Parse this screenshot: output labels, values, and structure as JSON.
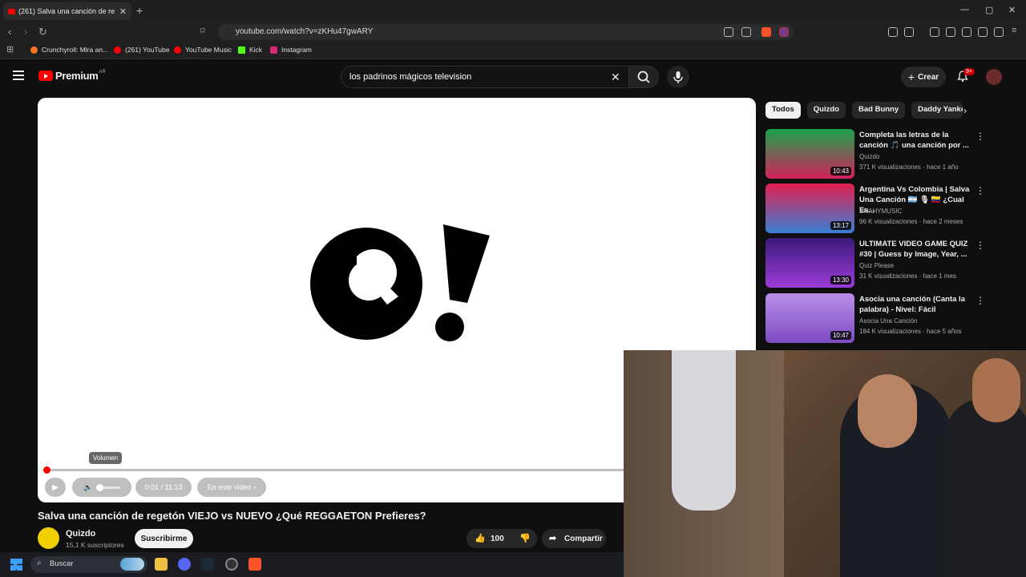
{
  "browser": {
    "tab_title": "(261) Salva una canción de re",
    "url": "youtube.com/watch?v=zKHu47gwARY",
    "bookmarks": [
      {
        "label": "Crunchyroll: Mira an...",
        "color": "#f47521"
      },
      {
        "label": "(261) YouTube",
        "color": "#ff0000"
      },
      {
        "label": "YouTube Music",
        "color": "#ff0000"
      },
      {
        "label": "Kick",
        "color": "#53fc18"
      },
      {
        "label": "Instagram",
        "color": "#d62976"
      }
    ]
  },
  "youtube": {
    "logo_text": "Premium",
    "country": "AR",
    "search_value": "los padrinos mágicos television",
    "create_label": "Crear",
    "notif_count": "9+"
  },
  "player": {
    "tooltip": "Volumen",
    "time": "0:01 / 11:13",
    "chapters": "En este video",
    "progress_fraction": 0.0015
  },
  "video": {
    "title": "Salva una canción de regetón VIEJO vs NUEVO ¿Qué REGGAETON Prefieres?",
    "channel": "Quizdo",
    "subscribers": "15,1 K suscriptores",
    "subscribe_label": "Suscribirme",
    "likes": "100",
    "share_label": "Compartir"
  },
  "chips": [
    "Todos",
    "Quizdo",
    "Bad Bunny",
    "Daddy Yankee"
  ],
  "recommendations": [
    {
      "title": "Completa las letras de la canción 🎵 una canción por ...",
      "channel": "Quizdo",
      "meta": "371 K visualizaciones · hace 1 año",
      "duration": "10:43",
      "thumb_top": "#1aa34a",
      "thumb_bottom": "#d4215c"
    },
    {
      "title": "Argentina Vs Colombia | Salva Una Canción 🇦🇷 🎙 🇨🇴 ¿Cual Es...",
      "channel": "BRAHYMUSIC",
      "meta": "96 K visualizaciones · hace 2 meses",
      "duration": "13:17",
      "thumb_top": "#e0204d",
      "thumb_bottom": "#3a7fd5"
    },
    {
      "title": "ULTIMATE VIDEO GAME QUIZ #30 | Guess by Image, Year, ...",
      "channel": "Quiz Please",
      "meta": "31 K visualizaciones · hace 1 mes",
      "duration": "13:30",
      "thumb_top": "#3b1a7a",
      "thumb_bottom": "#9c3cd8"
    },
    {
      "title": "Asocia una canción (Canta la palabra) - Nivel: Fácil",
      "channel": "Asocia Una Canción",
      "meta": "184 K visualizaciones · hace 5 años",
      "duration": "10:47",
      "thumb_top": "#b98ee8",
      "thumb_bottom": "#7d4cc2"
    }
  ],
  "taskbar": {
    "search_placeholder": "Buscar"
  }
}
